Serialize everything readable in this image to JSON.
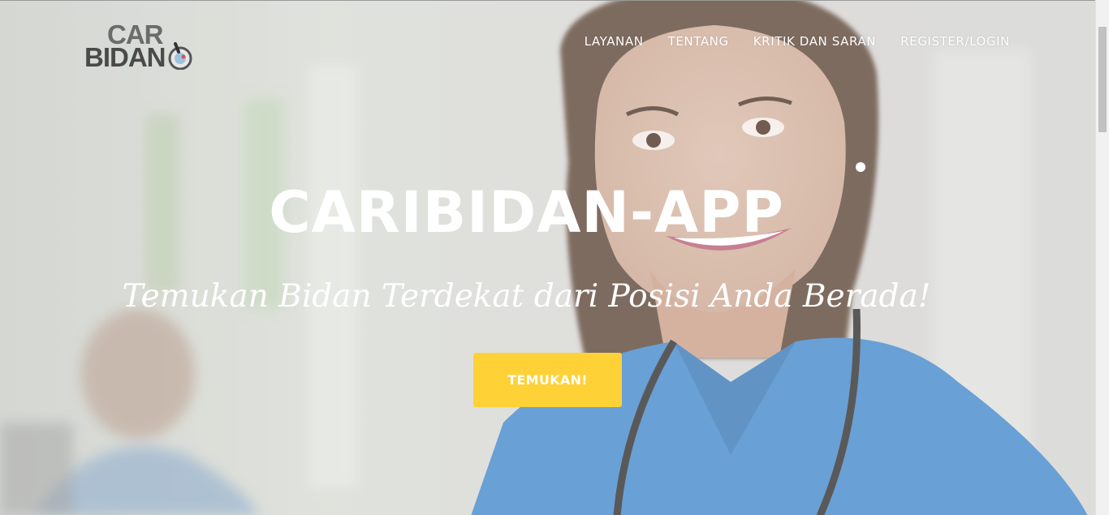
{
  "brand": {
    "logo_line1": "CAR",
    "logo_line2": "BIDAN",
    "logo_name": "CARI BIDAN"
  },
  "nav": {
    "items": [
      {
        "label": "LAYANAN"
      },
      {
        "label": "TENTANG"
      },
      {
        "label": "KRITIK DAN SARAN"
      },
      {
        "label": "REGISTER/LOGIN"
      }
    ]
  },
  "hero": {
    "title": "CARIBIDAN-APP",
    "subtitle": "Temukan Bidan Terdekat dari Posisi Anda Berada!",
    "cta_label": "TEMUKAN!",
    "background_image": "smiling-nurse-photo"
  },
  "colors": {
    "accent": "#fed136",
    "text_light": "#ffffff",
    "scrub_blue": "#3f86c9"
  }
}
